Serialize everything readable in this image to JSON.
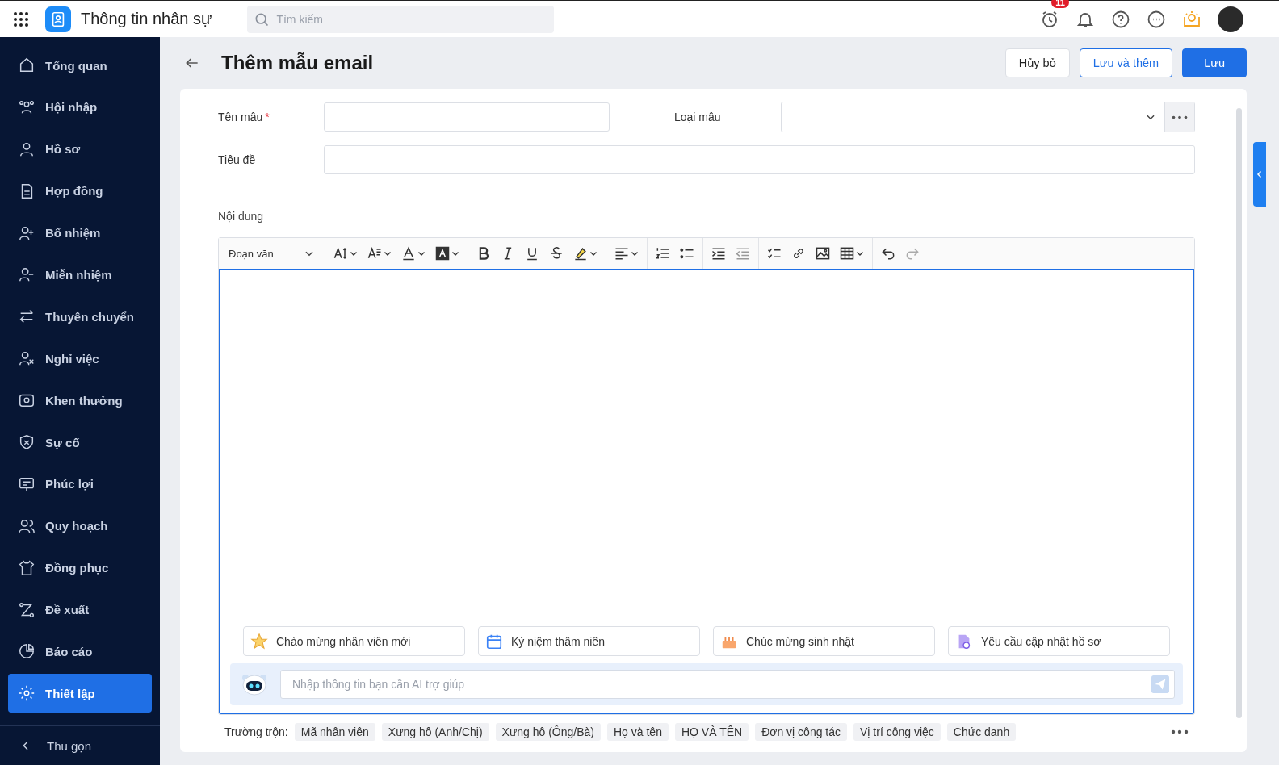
{
  "app": {
    "title": "Thông tin nhân sự",
    "search_placeholder": "Tìm kiếm",
    "notification_count": "11"
  },
  "sidebar": {
    "items": [
      {
        "label": "Tổng quan",
        "selected": false
      },
      {
        "label": "Hội nhập",
        "selected": false
      },
      {
        "label": "Hồ sơ",
        "selected": false
      },
      {
        "label": "Hợp đồng",
        "selected": false
      },
      {
        "label": "Bổ nhiệm",
        "selected": false
      },
      {
        "label": "Miễn nhiệm",
        "selected": false
      },
      {
        "label": "Thuyên chuyển",
        "selected": false
      },
      {
        "label": "Nghỉ việc",
        "selected": false
      },
      {
        "label": "Khen thưởng",
        "selected": false
      },
      {
        "label": "Sự cố",
        "selected": false
      },
      {
        "label": "Phúc lợi",
        "selected": false
      },
      {
        "label": "Quy hoạch",
        "selected": false
      },
      {
        "label": "Đồng phục",
        "selected": false
      },
      {
        "label": "Đề xuất",
        "selected": false
      },
      {
        "label": "Báo cáo",
        "selected": false
      },
      {
        "label": "Thiết lập",
        "selected": true
      }
    ],
    "collapse": "Thu gọn"
  },
  "page": {
    "title": "Thêm mẫu email",
    "buttons": [
      {
        "label": "Hủy bỏ",
        "kind": "default"
      },
      {
        "label": "Lưu và thêm",
        "kind": "outline"
      },
      {
        "label": "Lưu",
        "kind": "primary"
      }
    ]
  },
  "form": {
    "name": {
      "label": "Tên mẫu",
      "required_mark": "*"
    },
    "type": {
      "label": "Loại mẫu"
    },
    "subject": {
      "label": "Tiêu đề"
    },
    "content": {
      "label": "Nội dung"
    }
  },
  "editor": {
    "format": "Đoạn văn",
    "suggestions": [
      "Chào mừng nhân viên mới",
      "Kỷ niệm thâm niên",
      "Chúc mừng sinh nhật",
      "Yêu cầu cập nhật hồ sơ"
    ],
    "ai_placeholder": "Nhập thông tin bạn cần AI trợ giúp"
  },
  "merge_fields": {
    "label": "Trường trộn:",
    "items": [
      "Mã nhân viên",
      "Xưng hô (Anh/Chị)",
      "Xưng hô (Ông/Bà)",
      "Họ và tên",
      "HỌ VÀ TÊN",
      "Đơn vị công tác",
      "Vị trí công việc",
      "Chức danh"
    ]
  }
}
